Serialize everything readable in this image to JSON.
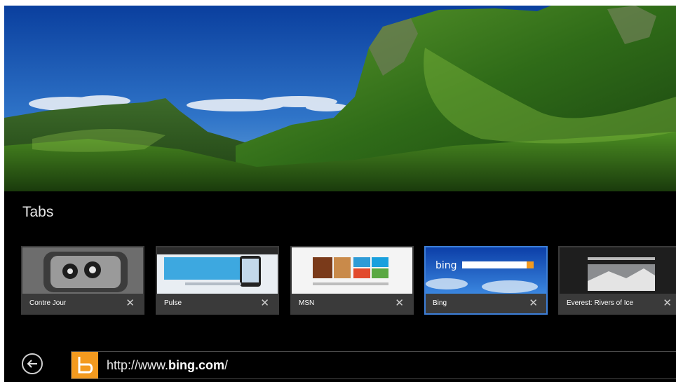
{
  "tabs_panel": {
    "title": "Tabs"
  },
  "tabs": [
    {
      "label": "Contre Jour",
      "active": false
    },
    {
      "label": "Pulse",
      "active": false
    },
    {
      "label": "MSN",
      "active": false
    },
    {
      "label": "Bing",
      "active": true
    },
    {
      "label": "Everest: Rivers of Ice",
      "active": false
    }
  ],
  "close_glyph": "✕",
  "address_bar": {
    "url_prefix": "http://www.",
    "url_domain": "bing.com",
    "url_suffix": "/",
    "site_icon_letter": "b",
    "site_icon_color": "#f39a1f"
  },
  "colors": {
    "active_tab_border": "#3d7fd9",
    "panel_background": "#000000"
  }
}
